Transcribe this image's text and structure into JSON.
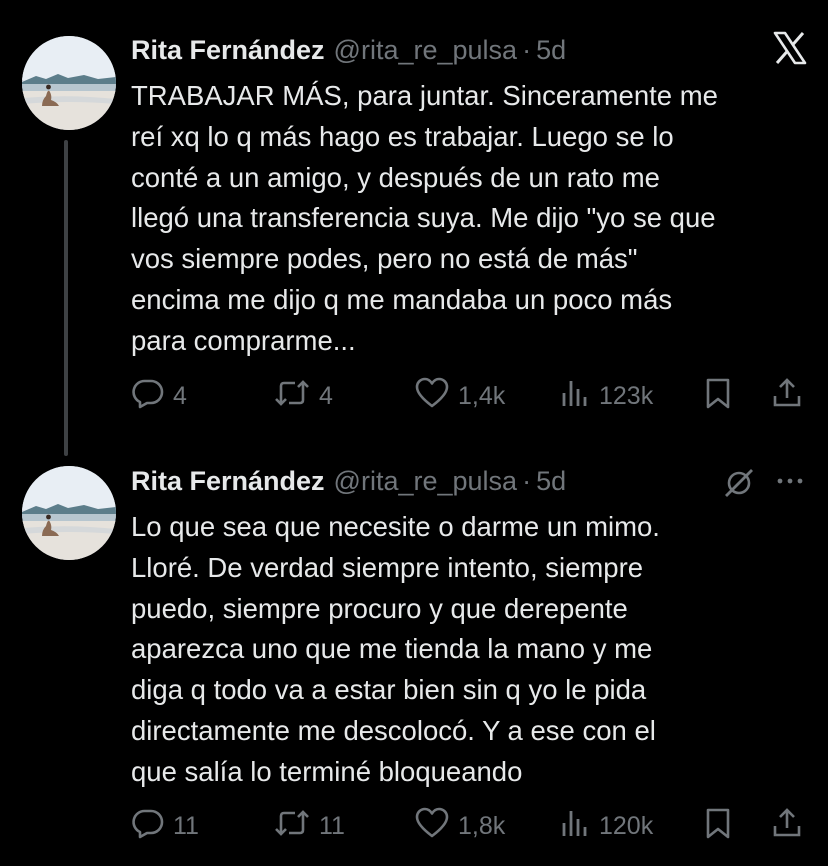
{
  "colors": {
    "background": "#000000",
    "text": "#e7e9ea",
    "secondary": "#71767b",
    "thread_line": "#3e4144"
  },
  "tweets": [
    {
      "author_name": "Rita Fernández",
      "handle": "@rita_re_pulsa",
      "separator": "·",
      "time": "5d",
      "corner_icon": "x-logo-icon",
      "lines": [
        "TRABAJAR MÁS, para juntar. Sinceramente me",
        "reí xq lo q más hago es trabajar. Luego se lo",
        "conté a un amigo, y después de un rato me",
        "llegó una transferencia suya. Me dijo \"yo se que",
        "vos siempre podes, pero no está de más\"",
        "encima me dijo q me mandaba un poco más",
        "para comprarme..."
      ],
      "replies": "4",
      "reposts": "4",
      "likes": "1,4k",
      "views": "123k",
      "action_icons": [
        "reply-icon",
        "repost-icon",
        "like-icon",
        "views-icon",
        "bookmark-icon",
        "share-icon"
      ]
    },
    {
      "author_name": "Rita Fernández",
      "handle": "@rita_re_pulsa",
      "separator": "·",
      "time": "5d",
      "corner_icons": [
        "grok-icon",
        "more-icon"
      ],
      "lines": [
        "Lo que sea que necesite o darme un mimo.",
        "Lloré. De verdad siempre intento, siempre",
        "puedo, siempre procuro y que derepente",
        "aparezca uno que me tienda la mano y me",
        "diga q todo va a estar bien sin q yo le pida",
        "directamente me descolocó. Y a ese con el",
        "que salía lo terminé bloqueando"
      ],
      "replies": "11",
      "reposts": "11",
      "likes": "1,8k",
      "views": "120k",
      "action_icons": [
        "reply-icon",
        "repost-icon",
        "like-icon",
        "views-icon",
        "bookmark-icon",
        "share-icon"
      ]
    }
  ]
}
